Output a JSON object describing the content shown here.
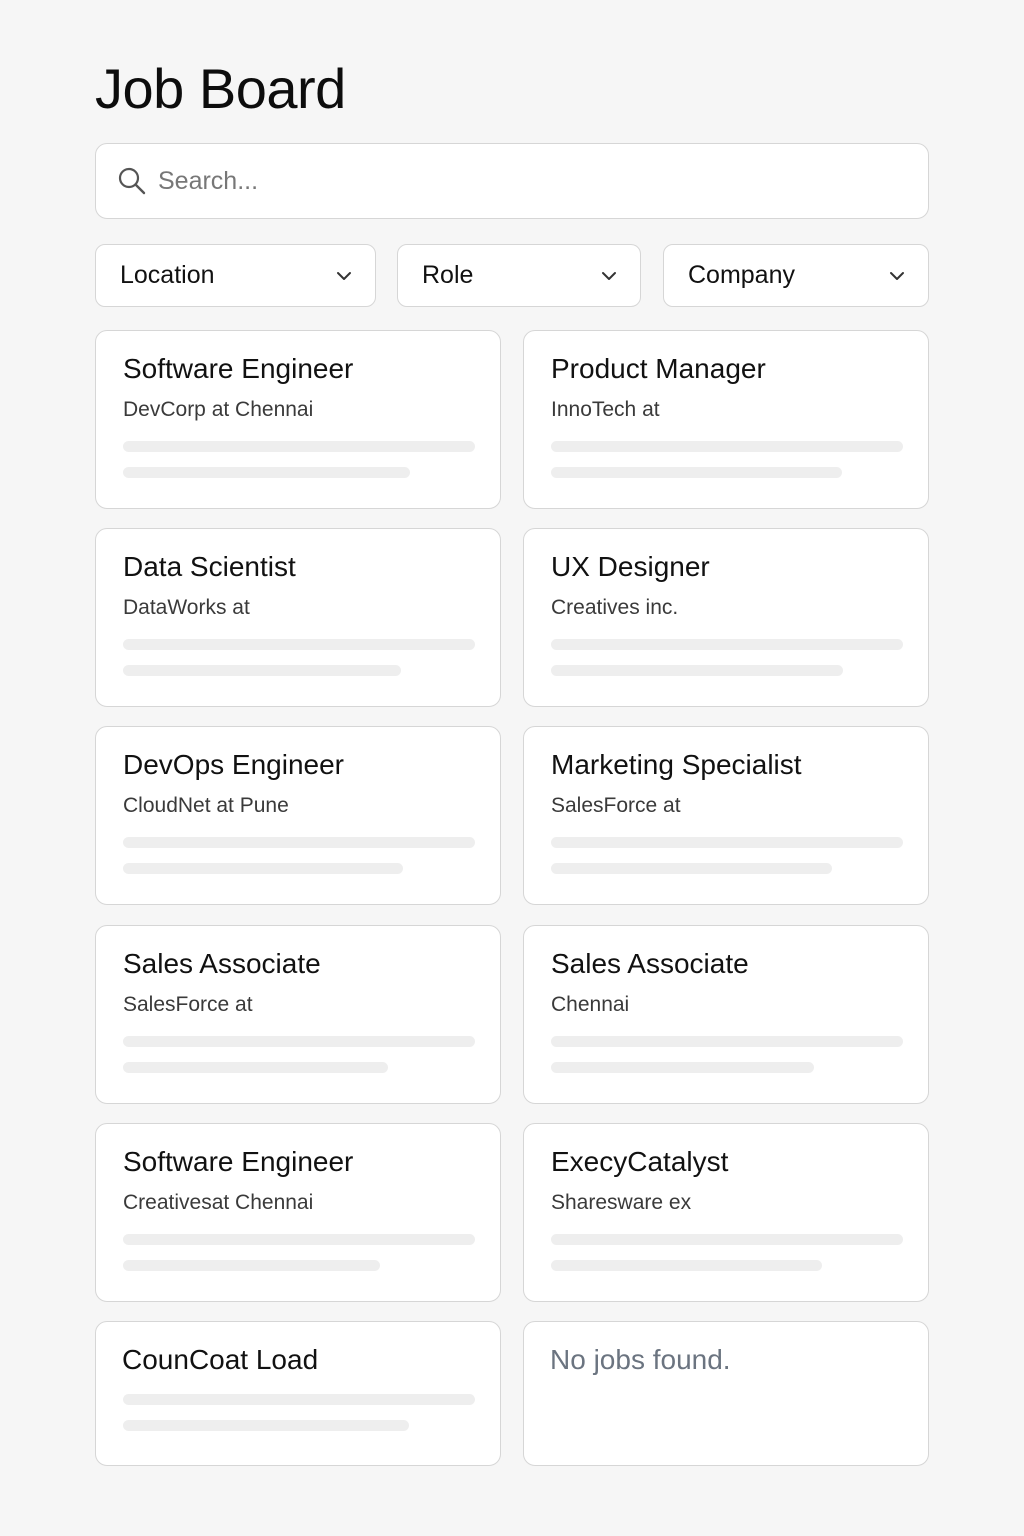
{
  "header": {
    "title": "Job Board"
  },
  "search": {
    "placeholder": "Search..."
  },
  "filters": {
    "location": "Location",
    "role": "Role",
    "company": "Company"
  },
  "jobs": [
    {
      "title": "Software Engineer",
      "subtitle": "DevCorp at Chennai"
    },
    {
      "title": "Product Manager",
      "subtitle": "InnoTech at"
    },
    {
      "title": "Data Scientist",
      "subtitle": "DataWorks at"
    },
    {
      "title": "UX Designer",
      "subtitle": "Creatives inc."
    },
    {
      "title": "DevOps Engineer",
      "subtitle": "CloudNet at Pune"
    },
    {
      "title": "Marketing Specialist",
      "subtitle": "SalesForce at"
    },
    {
      "title": "Sales Associate",
      "subtitle": "SalesForce at"
    },
    {
      "title": "Sales Associate",
      "subtitle": "Chennai"
    },
    {
      "title": "Software Engineer",
      "subtitle": "Creativesat Chennai"
    },
    {
      "title": "ExecyCatalyst",
      "subtitle": "Sharesware ex"
    },
    {
      "title": "CounCoat Load"
    }
  ],
  "empty_state": {
    "message": "No jobs found."
  },
  "icons": {
    "search": "search-icon",
    "dropdown": "chevron-down-icon"
  },
  "colors": {
    "background": "#f6f6f6",
    "card": "#ffffff",
    "border": "#d6d6d6",
    "muted_text": "#6b7480"
  }
}
